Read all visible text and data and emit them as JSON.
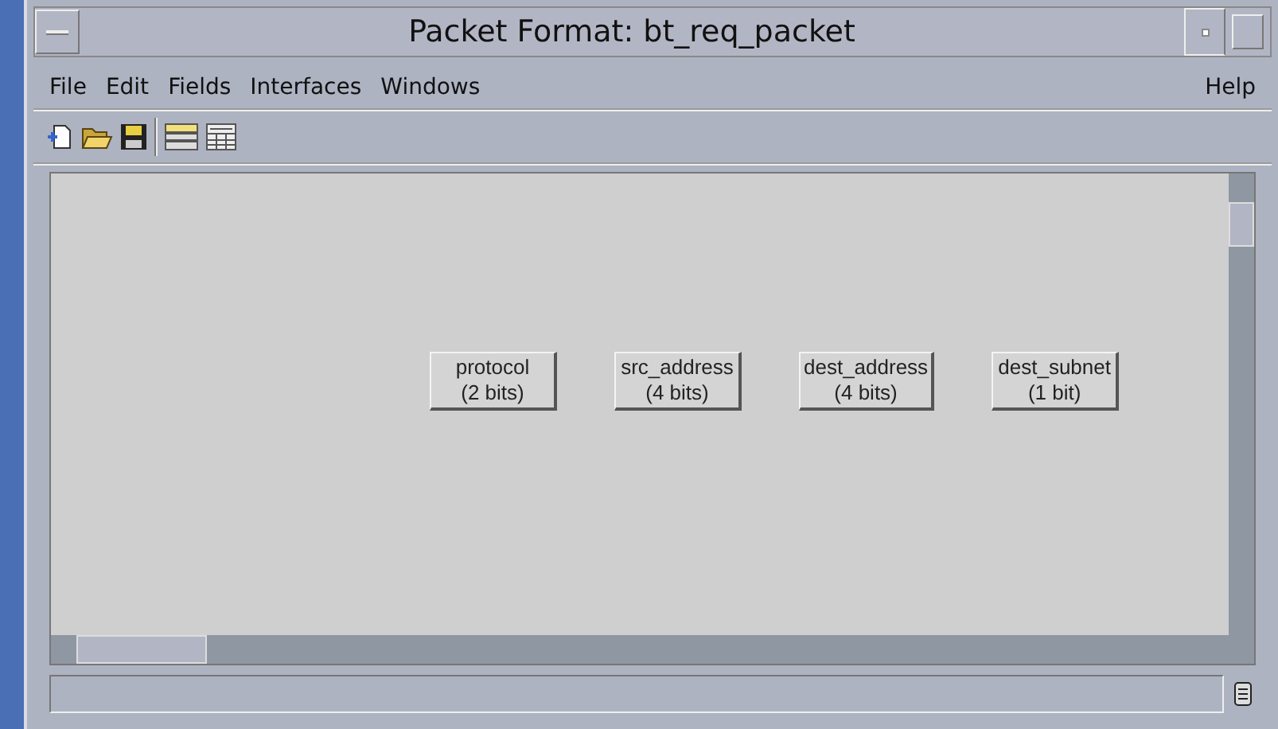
{
  "window": {
    "title": "Packet Format: bt_req_packet"
  },
  "menu": [
    {
      "label": "File"
    },
    {
      "label": "Edit"
    },
    {
      "label": "Fields"
    },
    {
      "label": "Interfaces"
    },
    {
      "label": "Windows"
    },
    {
      "label": "Help",
      "kind": "right"
    }
  ],
  "toolbar": [
    {
      "kind": "new"
    },
    {
      "kind": "open"
    },
    {
      "kind": "save"
    },
    {
      "kind": "separator"
    },
    {
      "kind": "fields"
    },
    {
      "kind": "table"
    }
  ],
  "fields": [
    {
      "name": "protocol",
      "size": "(2 bits)"
    },
    {
      "name": "src_address",
      "size": "(4 bits)"
    },
    {
      "name": "dest_address",
      "size": "(4 bits)"
    },
    {
      "name": "dest_subnet",
      "size": "(1 bit)"
    }
  ]
}
